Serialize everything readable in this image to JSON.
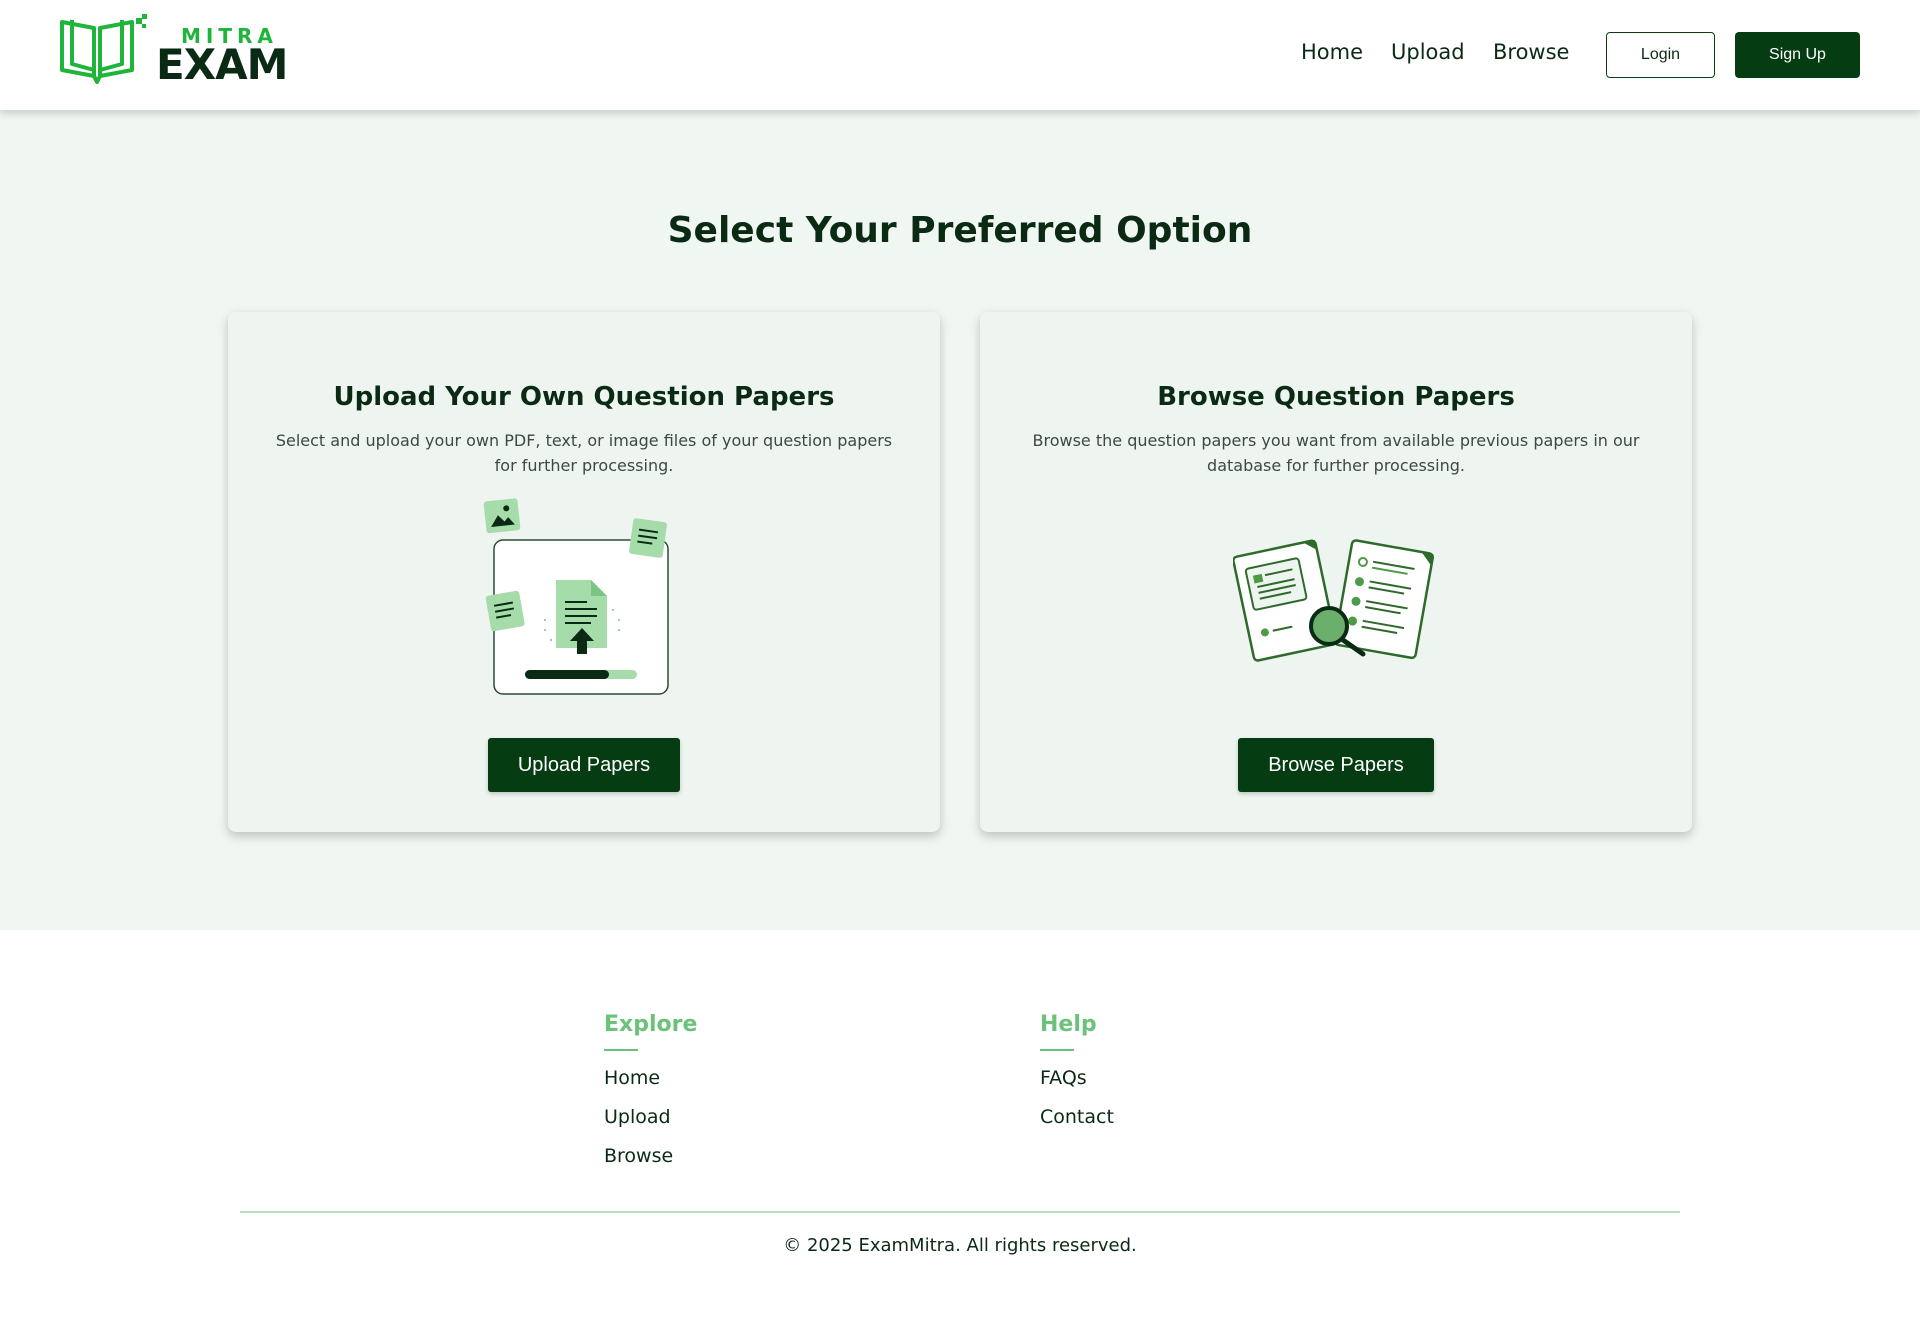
{
  "brand": {
    "logo_top": "MITRA",
    "logo_main": "EXAM"
  },
  "nav": {
    "links": [
      "Home",
      "Upload",
      "Browse"
    ],
    "login_label": "Login",
    "signup_label": "Sign Up"
  },
  "main": {
    "title": "Select Your Preferred Option",
    "cards": [
      {
        "title": "Upload Your Own Question Papers",
        "description": "Select and upload your own PDF, text, or image files of your question papers for further processing.",
        "button_label": "Upload Papers",
        "illustration": "upload-illustration"
      },
      {
        "title": "Browse Question Papers",
        "description": "Browse the question papers you want from available previous papers in our database for further processing.",
        "button_label": "Browse Papers",
        "illustration": "browse-illustration"
      }
    ]
  },
  "footer": {
    "explore": {
      "heading": "Explore",
      "links": [
        "Home",
        "Upload",
        "Browse"
      ]
    },
    "help": {
      "heading": "Help",
      "links": [
        "FAQs",
        "Contact"
      ]
    },
    "copyright": "© 2025 ExamMitra. All rights reserved."
  },
  "colors": {
    "primary_dark": "#053c12",
    "accent_green": "#1fb43a",
    "light_green": "#6cc27a",
    "background": "#f0f6f1"
  }
}
